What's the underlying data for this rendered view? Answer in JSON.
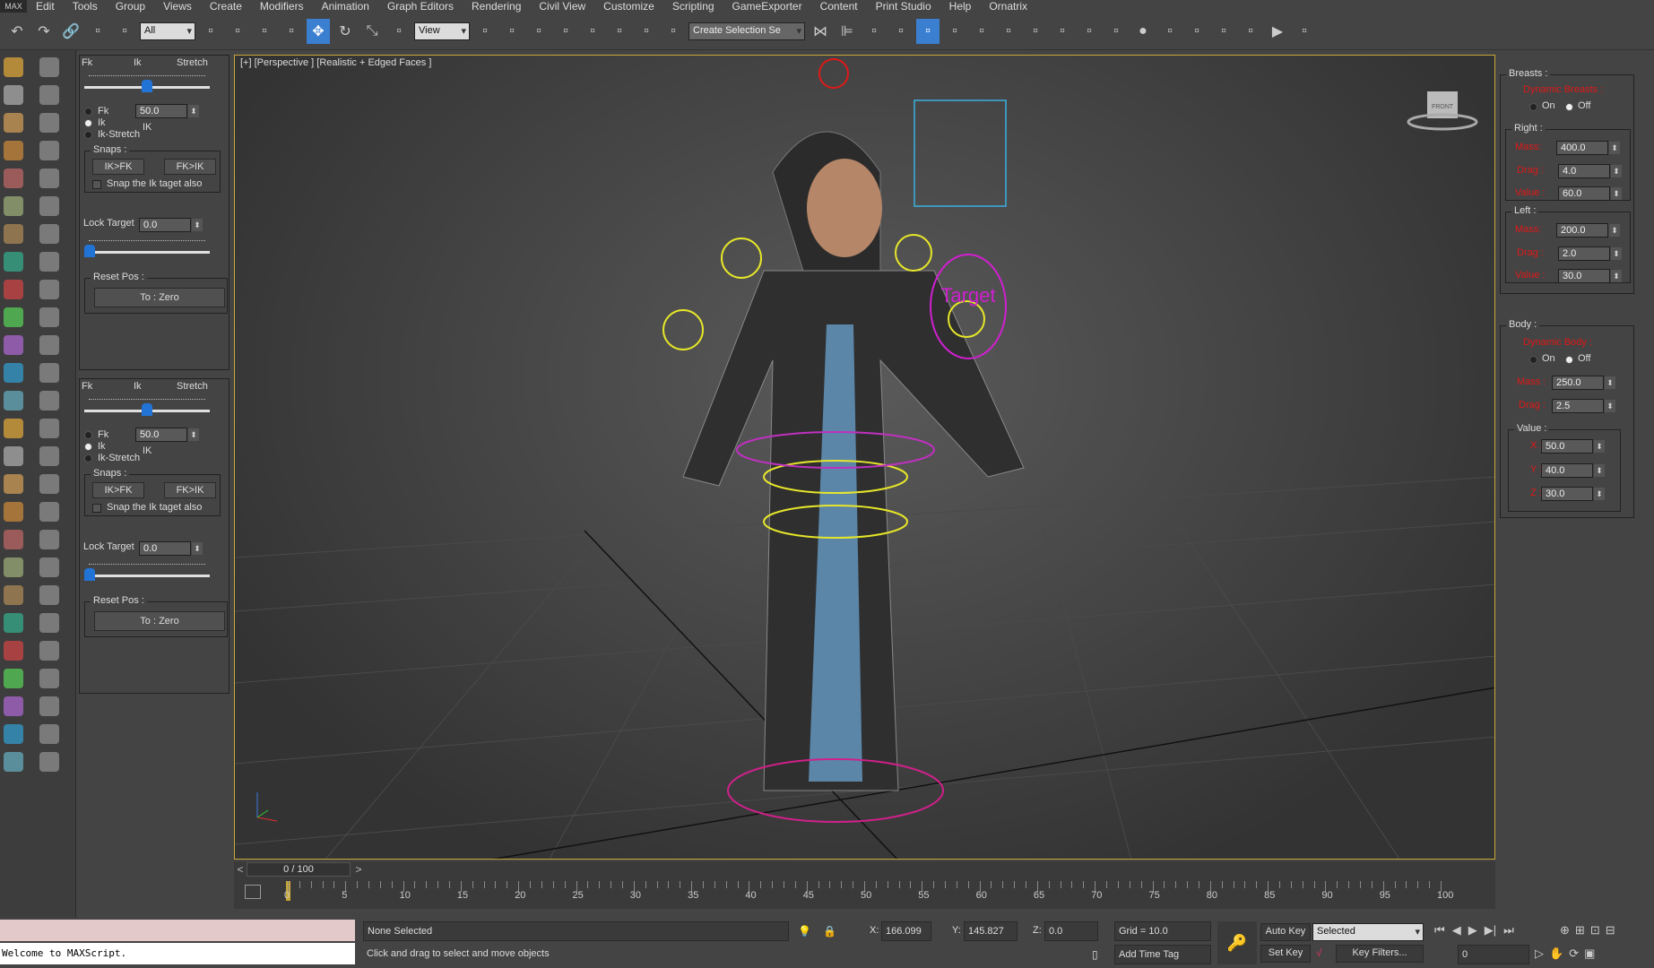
{
  "menu": [
    "Edit",
    "Tools",
    "Group",
    "Views",
    "Create",
    "Modifiers",
    "Animation",
    "Graph Editors",
    "Rendering",
    "Civil View",
    "Customize",
    "Scripting",
    "GameExporter",
    "Content",
    "Print Studio",
    "Help",
    "Ornatrix"
  ],
  "app_logo": "MAX",
  "toolbar": {
    "selection_filter": "All",
    "ref_coord": "View",
    "named_selection": "Create Selection Se",
    "icons_a": [
      "undo-icon",
      "redo-icon",
      "link-icon",
      "unlink-icon",
      "bind-spacewarp-icon"
    ],
    "icons_b": [
      "select-object-icon",
      "select-by-name-icon",
      "rect-selection-icon",
      "window-crossing-icon",
      "move-icon",
      "rotate-icon",
      "scale-icon",
      "placement-icon"
    ],
    "icons_c": [
      "select-manipulate-icon",
      "pivot-center-icon",
      "keyboard-shortcut-icon",
      "snap-3d-icon",
      "angle-snap-icon",
      "percent-snap-icon",
      "spinner-snap-icon",
      "edit-named-sel-icon"
    ],
    "icons_d": [
      "mirror-icon",
      "align-icon",
      "layer-explorer-icon",
      "layer-icon",
      "scene-explorer-icon",
      "curve-editor-icon",
      "schematic-view-icon",
      "material-editor-icon",
      "render-setup-icon",
      "rendered-frame-icon",
      "render-icon",
      "a360-icon",
      "sphere-icon",
      "shirt-icon",
      "brush-icon",
      "sparkle-icon",
      "prev-key-icon",
      "play-icon",
      "next-key-icon"
    ]
  },
  "rig_panels": [
    {
      "fk": "Fk",
      "ik": "Ik",
      "stretch": "Stretch",
      "slider_value": 0.5,
      "radio_fk": "Fk",
      "radio_ik": "Ik",
      "radio_stretch": "Ik-Stretch",
      "mode": "IK",
      "value": "50.0",
      "snaps_label": "Snaps :",
      "ik_fk": "IK>FK",
      "fk_ik": "FK>IK",
      "snap_check": "Snap the Ik taget also",
      "lock_label": "Lock Target",
      "lock_value": "0.0",
      "lock_slider": 0,
      "reset_label": "Reset Pos :",
      "reset_button": "To : Zero"
    },
    {
      "fk": "Fk",
      "ik": "Ik",
      "stretch": "Stretch",
      "slider_value": 0.5,
      "radio_fk": "Fk",
      "radio_ik": "Ik",
      "radio_stretch": "Ik-Stretch",
      "mode": "IK",
      "value": "50.0",
      "snaps_label": "Snaps :",
      "ik_fk": "IK>FK",
      "fk_ik": "FK>IK",
      "snap_check": "Snap the Ik taget also",
      "lock_label": "Lock Target",
      "lock_value": "0.0",
      "lock_slider": 0,
      "reset_label": "Reset Pos :",
      "reset_button": "To : Zero"
    }
  ],
  "viewport": {
    "label": "[+] [Perspective ] [Realistic + Edged Faces ]",
    "target_text": "Target",
    "viewcube": "FRONT"
  },
  "right_panel": {
    "breasts": {
      "title": "Breasts :",
      "dynamic": "Dynamic Breasts :",
      "on": "On",
      "off": "Off",
      "right": {
        "title": "Right :",
        "mass_label": "Mass:",
        "mass": "400.0",
        "drag_label": "Drag :",
        "drag": "4.0",
        "value_label": "Value :",
        "value": "60.0"
      },
      "left": {
        "title": "Left :",
        "mass_label": "Mass:",
        "mass": "200.0",
        "drag_label": "Drag :",
        "drag": "2.0",
        "value_label": "Value :",
        "value": "30.0"
      }
    },
    "body": {
      "title": "Body :",
      "dynamic": "Dynamic Body :",
      "on": "On",
      "off": "Off",
      "mass_label": "Mass :",
      "mass": "250.0",
      "drag_label": "Drag :",
      "drag": "2.5",
      "value_title": "Value :",
      "x_label": "X :",
      "x": "50.0",
      "y_label": "Y :",
      "y": "40.0",
      "z_label": "Z :",
      "z": "30.0"
    }
  },
  "timeline": {
    "frame": "0 / 100",
    "prev": "<",
    "next": ">",
    "ticks": [
      "0",
      "5",
      "10",
      "15",
      "20",
      "25",
      "30",
      "35",
      "40",
      "45",
      "50",
      "55",
      "60",
      "65",
      "70",
      "75",
      "80",
      "85",
      "90",
      "95",
      "100"
    ]
  },
  "status": {
    "maxscript_output": "Welcome to MAXScript.",
    "selection": "None Selected",
    "prompt": "Click and drag to select and move objects",
    "x_label": "X:",
    "x": "166.099",
    "y_label": "Y:",
    "y": "145.827",
    "z_label": "Z:",
    "z": "0.0",
    "grid": "Grid = 10.0",
    "add_time_tag": "Add Time Tag",
    "auto_key": "Auto Key",
    "set_key": "Set Key",
    "key_mode": "Selected",
    "key_filters": "Key Filters...",
    "current_frame": "0"
  },
  "colors": {
    "accent": "#3b7fd1",
    "rig_green": "#2ee82e",
    "param_red": "#e01818",
    "viewport_border": "#c8a837"
  }
}
